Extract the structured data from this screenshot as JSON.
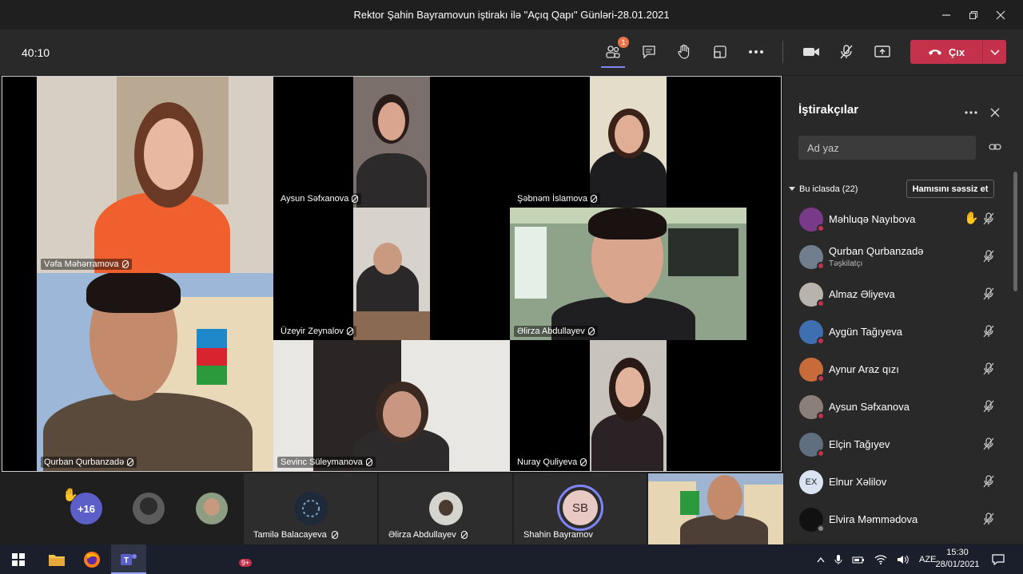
{
  "window": {
    "title": "Rektor Şahin Bayramovun iştirakı ilə \"Açıq Qapı\" Günləri-28.01.2021",
    "controls": [
      "minimize-icon",
      "maximize-icon",
      "close-icon"
    ]
  },
  "toolbar": {
    "timer": "40:10",
    "participants_badge": "1",
    "leave_label": "Çıx",
    "accent": "#c4314b"
  },
  "stage": {
    "tiles": [
      {
        "name": "Vəfa Məhərramova"
      },
      {
        "name": "Aysun Səfxanova"
      },
      {
        "name": "Şəbnəm İslamova"
      },
      {
        "name": "Üzeyir Zeynalov"
      },
      {
        "name": "Əlirza Abdullayev"
      },
      {
        "name": "Qurban Qurbanzadə"
      },
      {
        "name": "Sevinc Süleymanova"
      },
      {
        "name": "Nuray Quliyeva"
      }
    ]
  },
  "strip": {
    "hand": "✋",
    "more_count": "+16",
    "items": [
      {
        "name": "Tamilə Balacayeva"
      },
      {
        "name": "Əlirza Abdullayev"
      },
      {
        "name": "Shahin Bayramov",
        "initials": "SB"
      }
    ]
  },
  "panel": {
    "title": "İştirakçılar",
    "search_placeholder": "Ad yaz",
    "section_label": "Bu iclasda (22)",
    "mute_all_label": "Hamısını səssiz et",
    "people": [
      {
        "name": "Məhluqə Nayıbova",
        "role": "",
        "hand": "✋"
      },
      {
        "name": "Qurban Qurbanzadə",
        "role": "Təşkilatçı"
      },
      {
        "name": "Almaz Əliyeva",
        "role": ""
      },
      {
        "name": "Aygün Tağıyeva",
        "role": ""
      },
      {
        "name": "Aynur Araz qızı",
        "role": ""
      },
      {
        "name": "Aysun Səfxanova",
        "role": ""
      },
      {
        "name": "Elçin Tağıyev",
        "role": ""
      },
      {
        "name": "Elnur Xəlilov",
        "role": "",
        "initials": "EX"
      },
      {
        "name": "Elvira Məmmədova",
        "role": ""
      }
    ]
  },
  "taskbar": {
    "teams_badge": "9+",
    "language": "AZE",
    "time": "15:30",
    "date": "28/01/2021"
  }
}
